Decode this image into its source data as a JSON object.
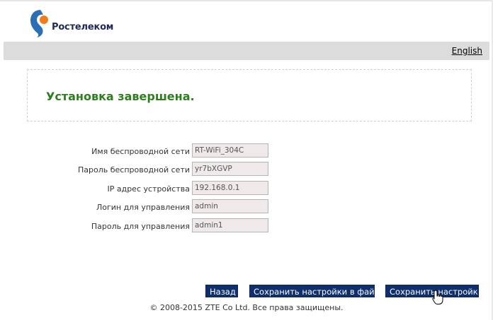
{
  "brand": {
    "name": "Ростелеком",
    "logo_icon": "rostelecom-logo-icon",
    "logo_colors": [
      "#2c6fb6",
      "#f07d1a"
    ]
  },
  "header": {
    "language_link": "English"
  },
  "status": {
    "message": "Установка завершена.",
    "color": "#2e7d1e"
  },
  "summary": {
    "fields": [
      {
        "label": "Имя беспроводной сети",
        "value": "RT-WiFi_304C"
      },
      {
        "label": "Пароль беспроводной сети",
        "value": "yr7bXGVP"
      },
      {
        "label": "IP адрес устройства",
        "value": "192.168.0.1"
      },
      {
        "label": "Логин для управления",
        "value": "admin"
      },
      {
        "label": "Пароль для управления",
        "value": "admin1"
      }
    ]
  },
  "actions": {
    "back_label": "Назад",
    "save_to_file_label": "Сохранить настройки в файл",
    "save_label": "Сохранить настройки",
    "button_color": "#0f2f6e"
  },
  "footer": {
    "copyright": "© 2008-2015 ZTE Co Ltd. Все права защищены."
  },
  "cursor": {
    "icon": "hand-pointer-icon"
  }
}
